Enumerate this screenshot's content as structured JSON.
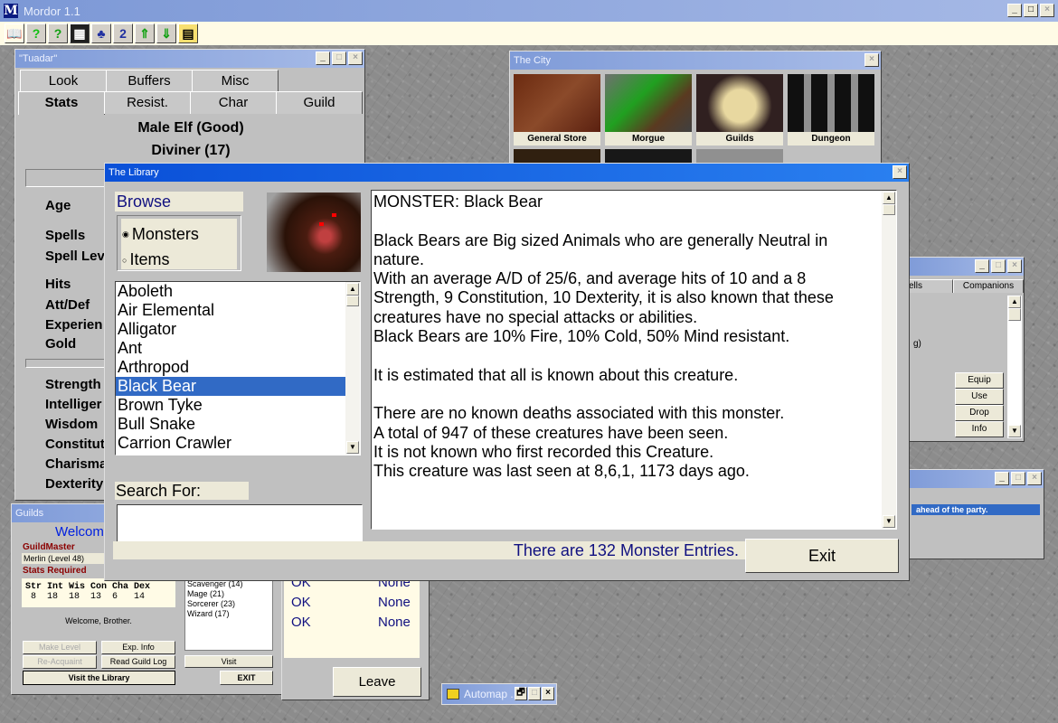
{
  "app": {
    "title": "Mordor 1.1",
    "logo": "M",
    "window_buttons": [
      "_",
      "□",
      "×"
    ],
    "toolbar_icons": [
      "book-icon",
      "help-icon",
      "context-help-icon",
      "map-icon",
      "party-icon",
      "swap-icon",
      "ascend-icon",
      "descend-icon",
      "windows-icon"
    ],
    "toolbar_glyphs": [
      "📖",
      "?",
      "?",
      "▦",
      "♣",
      "2",
      "⇑",
      "⇓",
      "▤"
    ]
  },
  "character_window": {
    "title": "\"Tuadar\"",
    "tabs_row1": [
      "Look",
      "Buffers",
      "Misc"
    ],
    "tabs_row2": [
      "Stats",
      "Resist.",
      "Char",
      "Guild"
    ],
    "active_tab": "Stats",
    "race_line": "Male Elf (Good)",
    "class_line": "Diviner (17)",
    "labels_group1": [
      "Age"
    ],
    "labels_group2": [
      "Spells",
      "Spell Lev"
    ],
    "labels_group3": [
      "Hits",
      "Att/Def",
      "Experien",
      "Gold"
    ],
    "labels_group4": [
      "Strength",
      "Intelliger",
      "Wisdom",
      "Constitut",
      "Charisma",
      "Dexterity"
    ]
  },
  "city_window": {
    "title": "The City",
    "locations": [
      {
        "label": "General Store",
        "accel": "S"
      },
      {
        "label": "Morgue",
        "accel": "M"
      },
      {
        "label": "Guilds",
        "accel": "G"
      },
      {
        "label": "Dungeon",
        "accel": "D"
      }
    ],
    "close": "×"
  },
  "library": {
    "title": "The Library",
    "close": "×",
    "browse_label": "Browse",
    "browse_options": [
      {
        "label": "Monsters",
        "selected": true
      },
      {
        "label": "Items",
        "selected": false
      }
    ],
    "list": [
      "Aboleth",
      "Air Elemental",
      "Alligator",
      "Ant",
      "Arthropod",
      "Black Bear",
      "Brown Tyke",
      "Bull Snake",
      "Carrion Crawler"
    ],
    "selected_index": 5,
    "search_label": "Search For:",
    "search_value": "",
    "description": [
      "MONSTER: Black Bear",
      "",
      "Black Bears are Big sized Animals who are generally Neutral in",
      "nature.",
      "With an average A/D of 25/6, and average hits of 10 and a 8",
      "Strength, 9 Constitution, 10 Dexterity, it is also known that these",
      "creatures have no special attacks or abilities.",
      "Black Bears are 10% Fire, 10% Cold, 50% Mind resistant.",
      "",
      "It is estimated that all is known about this creature.",
      "",
      "There are no known deaths associated with this monster.",
      "A total of 947 of these creatures have been seen.",
      "It is not known who first recorded this Creature.",
      "This creature was last seen at 8,6,1, 1173 days ago."
    ],
    "entry_count": "There are 132 Monster Entries.",
    "exit_label": "Exit"
  },
  "items_window": {
    "tabs": [
      "ells",
      "Companions"
    ],
    "partial_text": "g)",
    "buttons": [
      "Equip",
      "Use",
      "Drop",
      "Info"
    ]
  },
  "messages_window": {
    "selected_message": "ahead of the party."
  },
  "guilds_window": {
    "title": "Guilds",
    "welcome_heading": "Welcome",
    "guildmaster_label": "GuildMaster",
    "guildmaster_value": "Merlin (Level 48)",
    "stats_required_label": "Stats Required",
    "stats_header": "Str Int Wis Con Cha Dex",
    "stats_values": " 8  18  18  13  6   14",
    "welcome_msg": "Welcome, Brother.",
    "guild_list": [
      "Scavenger (14)",
      "Mage (21)",
      "Sorcerer (23)",
      "Wizard (17)"
    ],
    "buttons": {
      "make_level": "Make Level",
      "exp_info": "Exp. Info",
      "reacquaint": "Re-Acquaint",
      "read_log": "Read Guild Log",
      "visit_library": "Visit the Library",
      "visit": "Visit",
      "exit": "EXIT"
    }
  },
  "status_panel": {
    "rows": [
      {
        "status": "OK",
        "value": "None"
      },
      {
        "status": "OK",
        "value": "None"
      },
      {
        "status": "OK",
        "value": "None"
      }
    ],
    "leave_label": "Leave"
  },
  "automap": {
    "title": "Automap ...",
    "buttons": [
      "🗗",
      "□",
      "×"
    ]
  },
  "colors": {
    "title_active": "#0a50d8",
    "title_inactive": "#7f9bd8",
    "selection": "#316ac5",
    "library_accent": "#101080",
    "guild_red": "#8b0000"
  }
}
